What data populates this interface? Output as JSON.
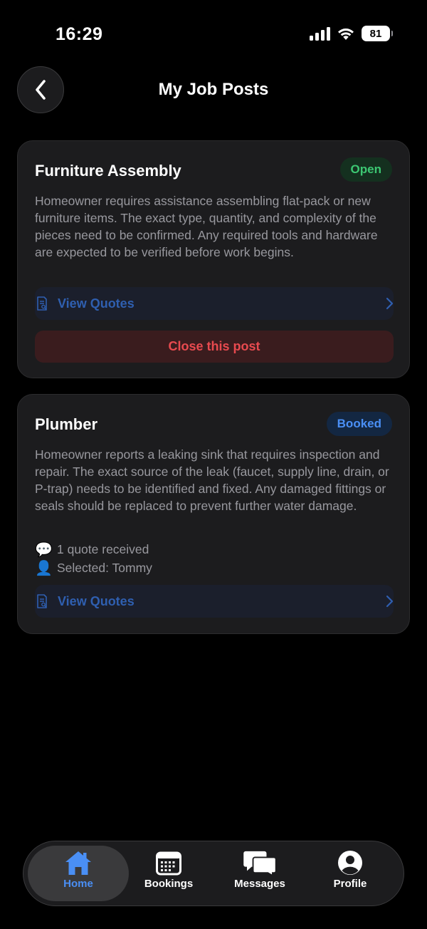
{
  "status_bar": {
    "time": "16:29",
    "battery": "81",
    "icons": [
      "signal-icon",
      "wifi-icon",
      "battery-icon"
    ]
  },
  "header": {
    "title": "My Job Posts",
    "back_icon": "chevron-left-icon"
  },
  "posts": [
    {
      "title": "Furniture Assembly",
      "status": "Open",
      "status_color": "#3cc772",
      "description": "Homeowner requires assistance assembling flat-pack or new furniture items. The exact type, quantity, and complexity of the pieces need to be confirmed. Any required tools and hardware are expected to be verified before work begins.",
      "view_quotes_label": "View Quotes",
      "close_label": "Close this post"
    },
    {
      "title": "Plumber",
      "status": "Booked",
      "status_color": "#4a8ff5",
      "description": "Homeowner reports a leaking sink that requires inspection and repair. The exact source of the leak (faucet, supply line, drain, or P-trap) needs to be identified and fixed. Any damaged fittings or seals should be replaced to prevent further water damage.",
      "quotes_received": "1 quote received",
      "selected": "Selected: Tommy",
      "view_quotes_label": "View Quotes"
    }
  ],
  "tab_bar": {
    "active": "Home",
    "accent_color": "#4a8ff5",
    "items": [
      {
        "label": "Home",
        "icon": "home-icon"
      },
      {
        "label": "Bookings",
        "icon": "calendar-icon"
      },
      {
        "label": "Messages",
        "icon": "chat-bubbles-icon"
      },
      {
        "label": "Profile",
        "icon": "profile-icon"
      }
    ]
  }
}
